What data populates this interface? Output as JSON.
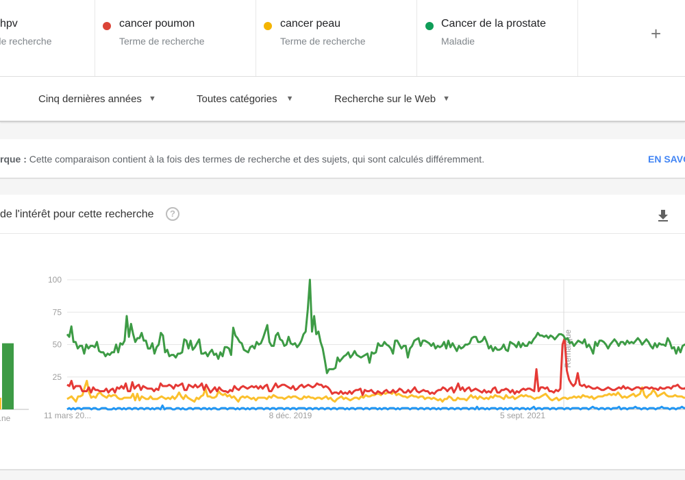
{
  "terms": [
    {
      "name": "hpv",
      "type": "Terme de recherche",
      "color": "#4285f4"
    },
    {
      "name": "cancer poumon",
      "type": "Terme de recherche",
      "color": "#db4437"
    },
    {
      "name": "cancer peau",
      "type": "Terme de recherche",
      "color": "#f4b400"
    },
    {
      "name": "Cancer de la prostate",
      "type": "Maladie",
      "color": "#0f9d58"
    }
  ],
  "add_term_label": "+",
  "filters": {
    "period": "Cinq dernières années",
    "category": "Toutes catégories",
    "search_type": "Recherche sur le Web"
  },
  "notice": {
    "prefix": "rque :",
    "text": "Cette comparaison contient à la fois des termes de recherche et des sujets, qui sont calculés différemment.",
    "link": "EN SAVO"
  },
  "panel": {
    "title": "de l'intérêt pour cette recherche",
    "help_icon": "?"
  },
  "chart_data": {
    "type": "line",
    "title": "Évolution de l'intérêt pour cette recherche",
    "xlabel": "",
    "ylabel": "",
    "ylim": [
      0,
      100
    ],
    "yticks": [
      "100",
      "75",
      "50",
      "25"
    ],
    "xtick_labels": [
      "11 mars 20...",
      "8 déc. 2019",
      "5 sept. 2021"
    ],
    "annotation": "Remarque",
    "grid": true,
    "average_bars": {
      "label": "...ne",
      "values": [
        {
          "series": "cancer peau",
          "value": 9
        },
        {
          "series": "Cancer de la prostate",
          "value": 51
        }
      ]
    },
    "series": [
      {
        "name": "Cancer de la prostate",
        "color": "#3d9b45",
        "values": [
          58,
          56,
          64,
          52,
          52,
          47,
          49,
          49,
          43,
          50,
          47,
          49,
          49,
          48,
          52,
          45,
          44,
          44,
          41,
          43,
          42,
          44,
          44,
          50,
          44,
          51,
          50,
          53,
          72,
          56,
          66,
          58,
          52,
          55,
          55,
          59,
          53,
          53,
          47,
          47,
          51,
          43,
          48,
          50,
          59,
          57,
          44,
          46,
          41,
          42,
          42,
          40,
          43,
          43,
          44,
          54,
          53,
          47,
          53,
          46,
          48,
          51,
          54,
          43,
          43,
          44,
          41,
          44,
          46,
          42,
          43,
          39,
          44,
          41,
          48,
          48,
          47,
          42,
          63,
          57,
          55,
          52,
          51,
          46,
          45,
          44,
          48,
          49,
          47,
          52,
          50,
          51,
          55,
          60,
          65,
          52,
          49,
          49,
          57,
          59,
          54,
          53,
          49,
          50,
          56,
          51,
          50,
          51,
          48,
          50,
          53,
          58,
          60,
          77,
          100,
          60,
          72,
          58,
          60,
          52,
          47,
          38,
          28,
          31,
          31,
          31,
          32,
          40,
          37,
          39,
          41,
          42,
          44,
          40,
          42,
          45,
          42,
          41,
          40,
          41,
          42,
          43,
          36,
          44,
          43,
          44,
          51,
          49,
          49,
          52,
          50,
          49,
          47,
          43,
          53,
          53,
          50,
          47,
          49,
          49,
          40,
          47,
          49,
          53,
          54,
          55,
          49,
          53,
          53,
          52,
          51,
          49,
          51,
          47,
          49,
          48,
          49,
          52,
          47,
          53,
          48,
          51,
          48,
          45,
          49,
          47,
          48,
          50,
          50,
          51,
          55,
          56,
          56,
          52,
          52,
          53,
          56,
          52,
          47,
          49,
          45,
          48,
          46,
          46,
          47,
          50,
          46,
          45,
          52,
          51,
          50,
          48,
          52,
          48,
          51,
          49,
          49,
          52,
          51,
          54,
          56,
          59,
          57,
          57,
          56,
          57,
          55,
          57,
          56,
          54,
          56,
          58,
          58,
          57,
          54,
          55,
          51,
          52,
          49,
          51,
          53,
          52,
          51,
          54,
          48,
          50,
          47,
          43,
          52,
          49,
          53,
          53,
          52,
          50,
          47,
          50,
          52,
          54,
          52,
          49,
          52,
          52,
          50,
          53,
          51,
          52,
          51,
          53,
          55,
          53,
          50,
          52,
          54,
          52,
          49,
          47,
          51,
          48,
          51,
          50,
          50,
          49,
          55,
          52,
          47,
          48,
          43,
          48,
          44,
          49,
          50,
          50,
          51,
          55,
          58,
          57,
          57,
          58,
          60,
          63,
          68,
          66,
          62,
          57
        ]
      },
      {
        "name": "cancer poumon",
        "color": "#e53935",
        "values": [
          19,
          18,
          22,
          16,
          18,
          18,
          18,
          14,
          14,
          14,
          17,
          13,
          17,
          15,
          15,
          14,
          14,
          14,
          16,
          13,
          15,
          16,
          13,
          17,
          16,
          18,
          16,
          20,
          14,
          14,
          21,
          16,
          18,
          19,
          15,
          18,
          17,
          16,
          16,
          16,
          14,
          16,
          15,
          20,
          18,
          18,
          18,
          19,
          18,
          16,
          19,
          18,
          19,
          20,
          15,
          15,
          19,
          18,
          17,
          19,
          17,
          18,
          20,
          15,
          19,
          16,
          13,
          15,
          17,
          14,
          17,
          15,
          14,
          14,
          13,
          15,
          14,
          18,
          16,
          15,
          17,
          18,
          17,
          16,
          17,
          18,
          17,
          18,
          16,
          18,
          16,
          18,
          19,
          14,
          14,
          17,
          20,
          17,
          18,
          19,
          19,
          18,
          17,
          16,
          18,
          15,
          16,
          18,
          19,
          17,
          18,
          19,
          18,
          17,
          18,
          20,
          19,
          19,
          17,
          18,
          17,
          15,
          12,
          13,
          13,
          12,
          14,
          12,
          13,
          12,
          14,
          12,
          14,
          15,
          15,
          16,
          11,
          15,
          14,
          14,
          15,
          13,
          12,
          14,
          13,
          12,
          14,
          15,
          13,
          13,
          15,
          13,
          14,
          16,
          15,
          13,
          13,
          15,
          13,
          15,
          17,
          14,
          13,
          14,
          15,
          14,
          14,
          12,
          13,
          12,
          14,
          15,
          15,
          17,
          16,
          14,
          16,
          17,
          13,
          16,
          20,
          15,
          17,
          14,
          16,
          17,
          14,
          15,
          16,
          15,
          14,
          13,
          15,
          13,
          14,
          13,
          16,
          17,
          13,
          13,
          15,
          15,
          16,
          15,
          13,
          15,
          12,
          14,
          13,
          15,
          16,
          15,
          16,
          16,
          15,
          14,
          31,
          14,
          17,
          17,
          16,
          17,
          14,
          14,
          13,
          15,
          14,
          16,
          50,
          55,
          30,
          23,
          20,
          18,
          20,
          28,
          19,
          18,
          19,
          17,
          18,
          17,
          16,
          16,
          17,
          16,
          15,
          15,
          16,
          17,
          16,
          15,
          15,
          16,
          17,
          16,
          18,
          16,
          17,
          16,
          15,
          16,
          17,
          17,
          16,
          16,
          17,
          17,
          16,
          17,
          16,
          16,
          15,
          17,
          16,
          16,
          17,
          17,
          16,
          18,
          18,
          19,
          17,
          16,
          16,
          17,
          16,
          17,
          16,
          18,
          17,
          17,
          18,
          16,
          16,
          17,
          16,
          18
        ]
      },
      {
        "name": "cancer peau",
        "color": "#fbc02d",
        "values": [
          8,
          9,
          10,
          8,
          6,
          10,
          10,
          11,
          17,
          22,
          13,
          9,
          10,
          9,
          12,
          13,
          11,
          10,
          9,
          11,
          10,
          11,
          11,
          9,
          8,
          8,
          9,
          9,
          9,
          9,
          12,
          7,
          12,
          7,
          10,
          9,
          8,
          8,
          10,
          8,
          8,
          8,
          9,
          10,
          9,
          8,
          9,
          8,
          10,
          8,
          10,
          13,
          10,
          8,
          11,
          9,
          8,
          7,
          6,
          9,
          8,
          10,
          11,
          16,
          10,
          10,
          9,
          9,
          10,
          14,
          12,
          11,
          12,
          10,
          11,
          9,
          10,
          8,
          6,
          9,
          10,
          9,
          10,
          9,
          8,
          9,
          7,
          9,
          9,
          9,
          9,
          8,
          10,
          9,
          11,
          10,
          9,
          9,
          9,
          8,
          9,
          10,
          9,
          10,
          10,
          9,
          8,
          8,
          10,
          9,
          10,
          9,
          9,
          8,
          9,
          9,
          8,
          9,
          10,
          8,
          9,
          7,
          6,
          8,
          9,
          10,
          8,
          9,
          8,
          7,
          8,
          9,
          9,
          8,
          10,
          9,
          11,
          10,
          10,
          11,
          11,
          12,
          12,
          11,
          13,
          12,
          13,
          13,
          12,
          14,
          11,
          12,
          11,
          10,
          10,
          9,
          10,
          11,
          10,
          10,
          9,
          10,
          10,
          8,
          9,
          9,
          8,
          9,
          8,
          7,
          8,
          6,
          8,
          8,
          10,
          9,
          7,
          7,
          9,
          8,
          8,
          8,
          7,
          9,
          11,
          9,
          10,
          8,
          10,
          9,
          8,
          9,
          8,
          10,
          9,
          11,
          10,
          10,
          9,
          8,
          11,
          9,
          9,
          10,
          8,
          9,
          10,
          11,
          10,
          11,
          10,
          10,
          9,
          8,
          9,
          9,
          10,
          11,
          12,
          10,
          8,
          7,
          8,
          9,
          7,
          8,
          9,
          9,
          8,
          9,
          9,
          10,
          9,
          10,
          9,
          11,
          10,
          10,
          9,
          10,
          8,
          9,
          10,
          10,
          10,
          11,
          11,
          12,
          11,
          12,
          11,
          13,
          11,
          9,
          10,
          9,
          10,
          11,
          12,
          10,
          11,
          12,
          17,
          11,
          9,
          11,
          12,
          15,
          13,
          10,
          11,
          12,
          13,
          11,
          10,
          10,
          10,
          11,
          10,
          10,
          10,
          9,
          9,
          10,
          10,
          10,
          10,
          9,
          11,
          10,
          11,
          10,
          11,
          8,
          9
        ]
      },
      {
        "name": "hpv",
        "color": "#2196f3",
        "values": [
          0,
          1,
          0,
          1,
          0,
          1,
          1,
          0,
          1,
          1,
          1,
          1,
          0,
          1,
          1,
          0,
          0,
          1,
          1,
          1,
          0,
          0,
          0,
          1,
          0,
          1,
          1,
          0,
          1,
          0,
          1,
          1,
          0,
          1,
          1,
          0,
          1,
          1,
          0,
          1,
          1,
          0,
          1,
          0,
          1,
          1,
          0,
          3,
          0,
          1,
          1,
          1,
          0,
          0,
          1,
          1,
          0,
          1,
          0,
          0,
          1,
          1,
          0,
          1,
          1,
          1,
          0,
          1,
          1,
          0,
          1,
          0,
          1,
          1,
          0,
          0,
          1,
          1,
          1,
          0,
          1,
          1,
          1,
          0,
          1,
          0,
          1,
          1,
          0,
          1,
          0,
          1,
          1,
          0,
          1,
          1,
          1,
          0,
          1,
          1,
          0,
          1,
          1,
          0,
          1,
          1,
          1,
          0,
          1,
          1,
          0,
          1,
          1,
          0,
          1,
          1,
          1,
          1,
          0,
          1,
          1,
          0,
          1,
          1,
          0,
          1,
          1,
          0,
          1,
          1,
          0,
          1,
          1,
          0,
          1,
          1,
          1,
          0,
          1,
          0,
          1,
          1,
          0,
          1,
          1,
          1,
          0,
          1,
          1,
          0,
          1,
          1,
          1,
          0,
          1,
          0,
          1,
          1,
          0,
          1,
          1,
          1,
          0,
          1,
          0,
          1,
          1,
          1,
          1,
          0,
          1,
          1,
          1,
          0,
          1,
          1,
          0,
          1,
          1,
          0,
          1,
          1,
          0,
          1,
          0,
          1,
          1,
          1,
          0,
          1,
          1,
          0,
          1,
          1,
          0,
          1,
          1,
          1,
          0,
          1,
          1,
          0,
          2,
          0,
          1,
          1,
          0,
          1,
          0,
          1,
          1,
          1,
          0,
          1,
          1,
          0,
          1,
          0,
          1,
          1,
          0,
          1,
          1,
          0,
          1,
          1,
          0,
          1,
          0,
          1,
          2,
          0,
          1,
          1,
          0,
          1,
          1,
          1,
          0,
          1,
          1,
          0,
          1,
          1,
          1,
          0,
          1,
          1,
          0,
          1,
          1,
          1,
          1,
          0,
          1,
          1,
          1,
          0,
          1,
          2,
          1,
          1,
          0,
          1,
          1,
          0,
          1,
          1,
          0,
          1,
          1,
          1,
          2,
          0,
          1,
          1,
          0,
          1,
          1,
          1,
          2,
          1,
          1,
          0,
          1,
          1,
          0,
          1,
          1,
          1,
          0,
          1,
          1,
          2,
          1,
          1,
          1,
          0,
          1,
          1,
          0,
          1,
          1,
          2,
          1,
          1,
          0,
          1,
          1,
          1,
          0,
          1,
          1,
          0,
          1,
          1,
          0,
          1,
          1
        ]
      }
    ]
  }
}
